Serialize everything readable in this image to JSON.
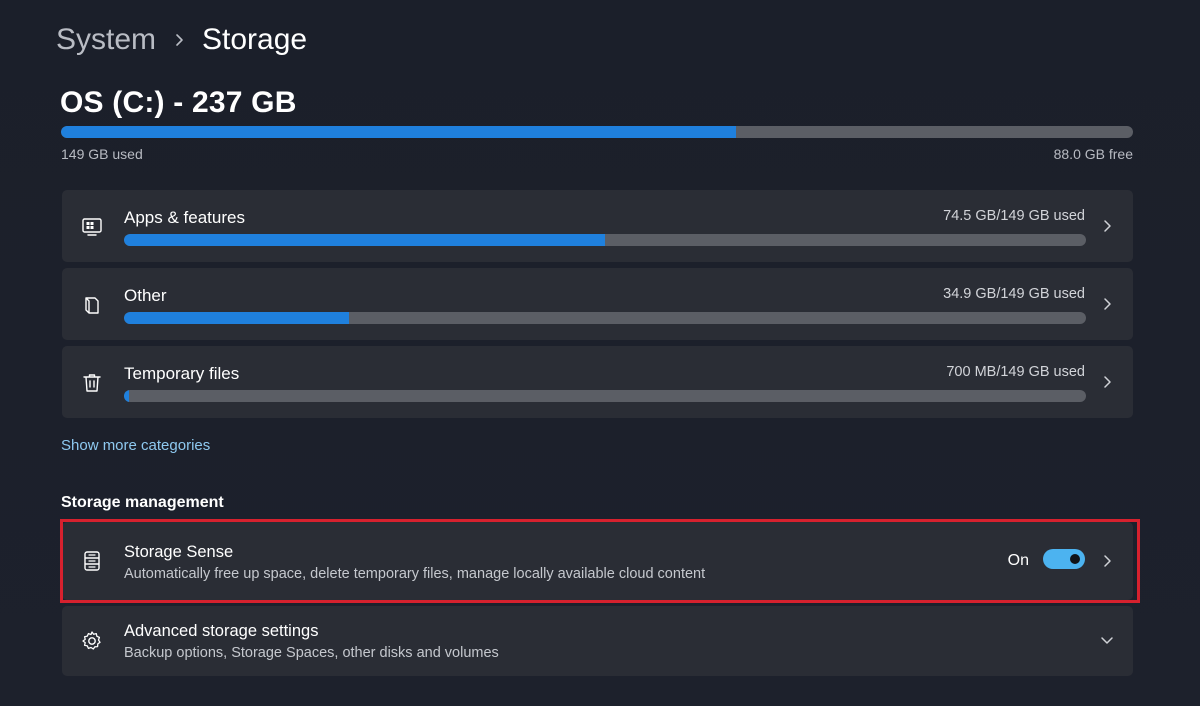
{
  "breadcrumb": {
    "parent": "System",
    "separator_icon": "chevron-right-icon",
    "current": "Storage"
  },
  "drive": {
    "title": "OS (C:) - 237 GB",
    "used_label": "149 GB used",
    "free_label": "88.0 GB free",
    "used_fraction": 0.63
  },
  "categories": [
    {
      "label": "Apps & features",
      "size": "74.5 GB/149 GB used",
      "fraction": 0.5,
      "icon": "apps-features-icon"
    },
    {
      "label": "Other",
      "size": "34.9 GB/149 GB used",
      "fraction": 0.234,
      "icon": "other-files-icon"
    },
    {
      "label": "Temporary files",
      "size": "700 MB/149 GB used",
      "fraction": 0.005,
      "icon": "trash-icon"
    }
  ],
  "show_more": "Show more categories",
  "storage_management": {
    "title": "Storage management",
    "storage_sense": {
      "title": "Storage Sense",
      "description": "Automatically free up space, delete temporary files, manage locally available cloud content",
      "toggle_label": "On",
      "toggle_on": true,
      "icon": "storage-drive-icon"
    },
    "advanced": {
      "title": "Advanced storage settings",
      "description": "Backup options, Storage Spaces, other disks and volumes",
      "icon": "gear-icon"
    }
  },
  "colors": {
    "accent": "#1f80dd",
    "toggle_on": "#4cb3f0",
    "highlight": "#d6212e",
    "link": "#8ec9f0"
  }
}
